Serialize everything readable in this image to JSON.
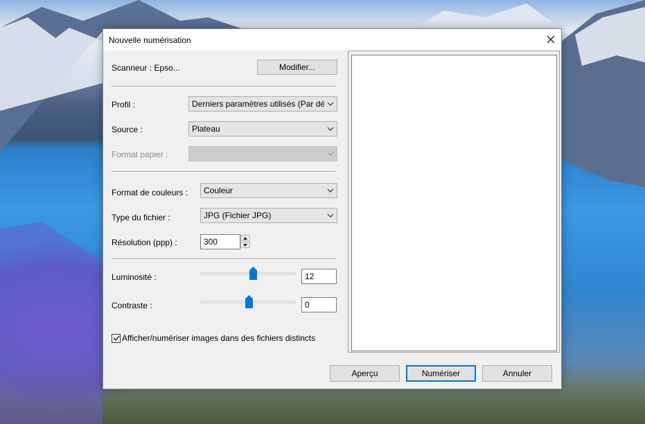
{
  "window": {
    "title": "Nouvelle numérisation"
  },
  "scanner": {
    "label": "Scanneur : Epso...",
    "change_button": "Modifier..."
  },
  "profile": {
    "label": "Profil :",
    "value": "Derniers paramètres utilisés (Par défa"
  },
  "source": {
    "label": "Source :",
    "value": "Plateau"
  },
  "paper_format": {
    "label": "Format papier :",
    "value": ""
  },
  "color_format": {
    "label": "Format de couleurs :",
    "value": "Couleur"
  },
  "file_type": {
    "label": "Type du fichier :",
    "value": "JPG (Fichier JPG)"
  },
  "resolution": {
    "label": "Résolution (ppp) :",
    "value": "300"
  },
  "brightness": {
    "label": "Luminosité :",
    "value": "12"
  },
  "contrast": {
    "label": "Contraste :",
    "value": "0"
  },
  "separate_files": {
    "label": "Afficher/numériser images dans des fichiers distincts",
    "checked": true
  },
  "buttons": {
    "preview": "Aperçu",
    "scan": "Numériser",
    "cancel": "Annuler"
  },
  "colors": {
    "accent": "#0078d7"
  },
  "icons": [
    "close-icon",
    "chevron-down-icon",
    "spin-up-icon",
    "spin-down-icon",
    "checkmark-icon"
  ]
}
